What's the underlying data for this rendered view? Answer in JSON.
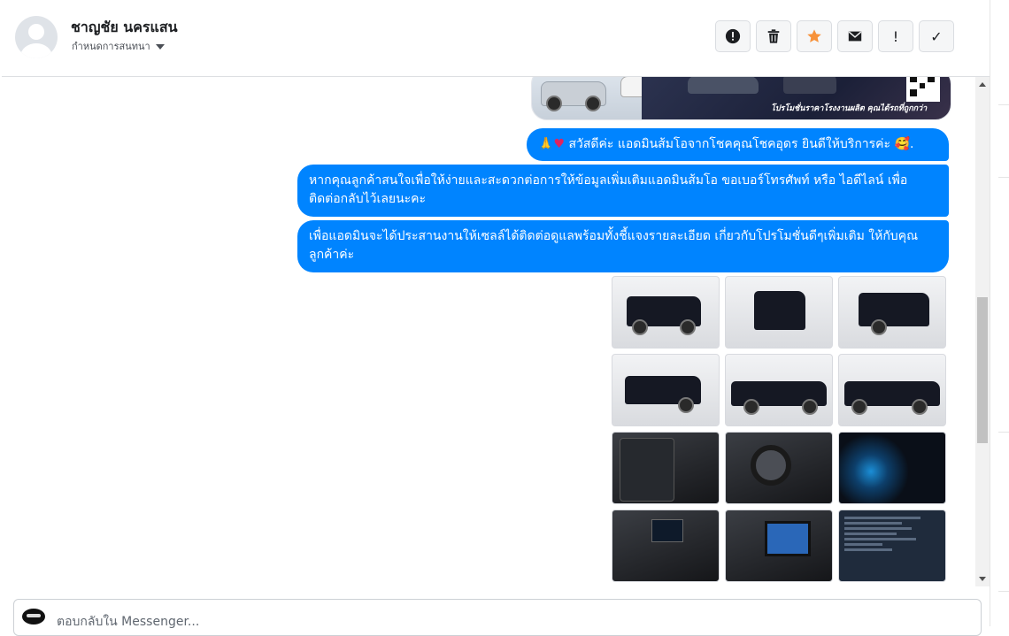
{
  "contact": {
    "name": "ชาญชัย นครแสน",
    "subtitle": "กำหนดการสนทนา"
  },
  "toolbar": {
    "buttons": [
      {
        "icon": "alert-circle-icon",
        "label": ""
      },
      {
        "icon": "trash-icon",
        "label": ""
      },
      {
        "icon": "star-icon",
        "label": "",
        "color": "#f7923a"
      },
      {
        "icon": "envelope-icon",
        "label": ""
      },
      {
        "icon": "exclamation-icon",
        "label": "!"
      },
      {
        "icon": "check-icon",
        "label": "✓"
      }
    ]
  },
  "promo": {
    "tagline": "โปรโมชั่นราคาโรงงานผลิต คุณได้รถที่ถูกกว่า"
  },
  "messages": [
    {
      "emoji": "🙏",
      "heart": "♥",
      "text": " สวัสดีค่ะ แอดมินส้มโอจากโชคคุณโชคอุดร ยินดีให้บริการค่ะ ",
      "emoji_end": "🥰."
    },
    {
      "text": "หากคุณลูกค้าสนใจเพื่อให้ง่ายและสะดวกต่อการให้ข้อมูลเพิ่มเติมแอดมินส้มโอ ขอเบอร์โทรศัพท์ หรือ ไอดีไลน์ เพื่อติดต่อกลับไว้เลยนะคะ"
    },
    {
      "text": "เพื่อแอดมินจะได้ประสานงานให้เซลล์ได้ติดต่อดูแลพร้อมทั้งชี้แจงรายละเอียด เกี่ยวกับโปรโมชั่นดีๆเพิ่มเติม ให้กับคุณลูกค้าค่ะ"
    }
  ],
  "reply": {
    "placeholder": "ตอบกลับใน Messenger..."
  },
  "colors": {
    "bubble": "#0084ff",
    "accent_star": "#f7923a"
  }
}
